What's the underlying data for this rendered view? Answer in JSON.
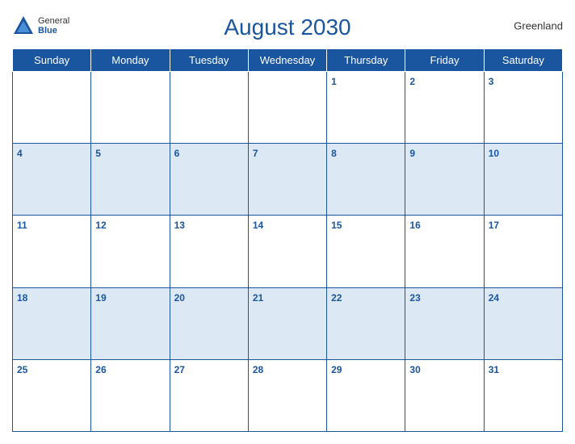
{
  "header": {
    "title": "August 2030",
    "country": "Greenland",
    "logo": {
      "general": "General",
      "blue": "Blue"
    }
  },
  "days_of_week": [
    "Sunday",
    "Monday",
    "Tuesday",
    "Wednesday",
    "Thursday",
    "Friday",
    "Saturday"
  ],
  "weeks": [
    [
      null,
      null,
      null,
      null,
      1,
      2,
      3
    ],
    [
      4,
      5,
      6,
      7,
      8,
      9,
      10
    ],
    [
      11,
      12,
      13,
      14,
      15,
      16,
      17
    ],
    [
      18,
      19,
      20,
      21,
      22,
      23,
      24
    ],
    [
      25,
      26,
      27,
      28,
      29,
      30,
      31
    ]
  ]
}
